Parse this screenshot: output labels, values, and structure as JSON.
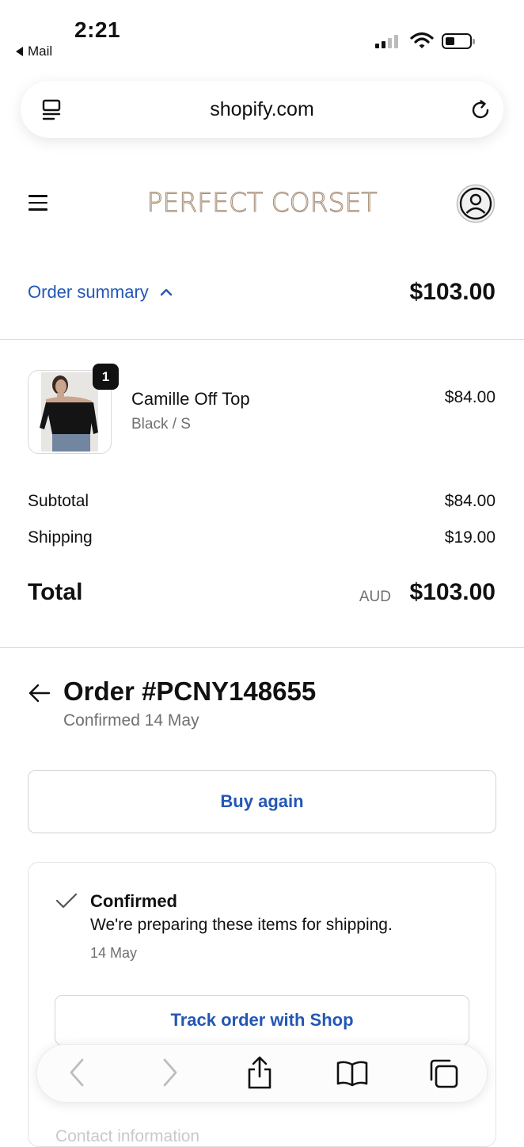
{
  "status_bar": {
    "time": "2:21",
    "back_app": "Mail"
  },
  "browser": {
    "url": "shopify.com"
  },
  "store": {
    "brand": "PERFECT CORSET"
  },
  "order_summary": {
    "toggle_label": "Order summary",
    "total": "$103.00",
    "item": {
      "quantity": "1",
      "name": "Camille Off Top",
      "variant": "Black / S",
      "price": "$84.00"
    },
    "subtotal_label": "Subtotal",
    "subtotal_value": "$84.00",
    "shipping_label": "Shipping",
    "shipping_value": "$19.00",
    "total_label": "Total",
    "currency": "AUD",
    "total_value": "$103.00"
  },
  "order": {
    "title": "Order #PCNY148655",
    "confirmed_date": "Confirmed 14 May",
    "buy_again_label": "Buy again",
    "status_title": "Confirmed",
    "status_message": "We're preparing these items for shipping.",
    "status_date": "14 May",
    "track_label": "Track order with Shop",
    "contact_heading": "Contact information"
  },
  "colors": {
    "accent": "#2357b4",
    "brand": "#a58b74",
    "muted": "#707070"
  }
}
